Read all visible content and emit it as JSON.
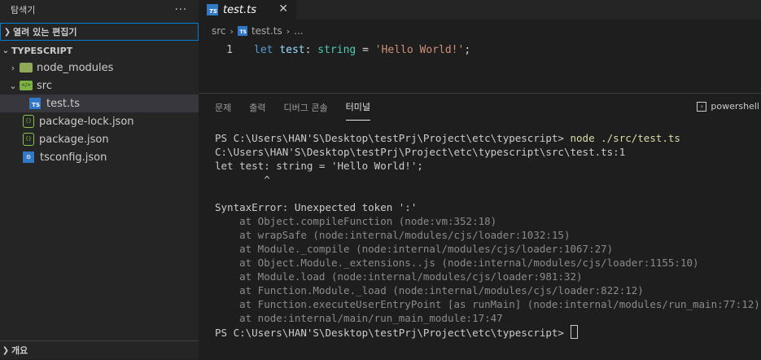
{
  "sidebar": {
    "title": "탐색기",
    "more": "···",
    "open_editors": "열려 있는 편집기",
    "project": "TYPESCRIPT",
    "items": [
      {
        "label": "node_modules"
      },
      {
        "label": "src"
      },
      {
        "label": "test.ts"
      },
      {
        "label": "package-lock.json"
      },
      {
        "label": "package.json"
      },
      {
        "label": "tsconfig.json"
      }
    ],
    "outline": "개요"
  },
  "editor": {
    "tab": {
      "label": "test.ts",
      "icon": "TS",
      "close": "✕"
    },
    "breadcrumb": {
      "folder": "src",
      "file": "test.ts",
      "more": "..."
    },
    "line_number": "1",
    "code": {
      "kw": "let",
      "var": "test",
      "colon": ":",
      "type": "string",
      "eq": " = ",
      "str": "'Hello World!'",
      "semi": ";"
    }
  },
  "panel": {
    "tabs": [
      "문제",
      "출력",
      "디버그 콘솔",
      "터미널"
    ],
    "active_tab": "터미널",
    "shell": "powershell",
    "terminal": {
      "prompt1": "PS C:\\Users\\HAN'S\\Desktop\\testPrj\\Project\\etc\\typescript> ",
      "command1": "node ./src/test.ts",
      "lines": [
        "C:\\Users\\HAN'S\\Desktop\\testPrj\\Project\\etc\\typescript\\src\\test.ts:1",
        "let test: string = 'Hello World!';",
        "        ^",
        "",
        "SyntaxError: Unexpected token ':'"
      ],
      "stack": [
        "    at Object.compileFunction (node:vm:352:18)",
        "    at wrapSafe (node:internal/modules/cjs/loader:1032:15)",
        "    at Module._compile (node:internal/modules/cjs/loader:1067:27)",
        "    at Object.Module._extensions..js (node:internal/modules/cjs/loader:1155:10)",
        "    at Module.load (node:internal/modules/cjs/loader:981:32)",
        "    at Function.Module._load (node:internal/modules/cjs/loader:822:12)",
        "    at Function.executeUserEntryPoint [as runMain] (node:internal/modules/run_main:77:12)",
        "    at node:internal/main/run_main_module:17:47"
      ],
      "prompt2": "PS C:\\Users\\HAN'S\\Desktop\\testPrj\\Project\\etc\\typescript> "
    }
  },
  "colors": {
    "accent": "#007fd4",
    "ts_blue": "#3178c6",
    "json_green": "#8bc34a"
  }
}
